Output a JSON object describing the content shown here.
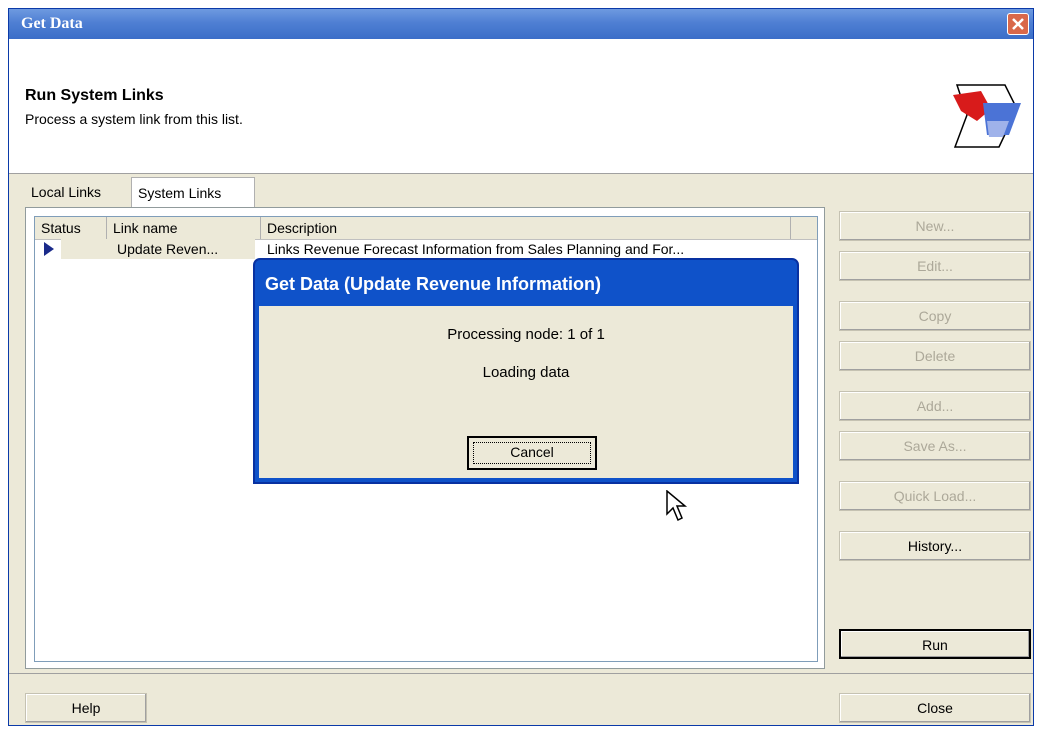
{
  "window": {
    "title": "Get Data"
  },
  "header": {
    "title": "Run System Links",
    "subtitle": "Process a system link from this list."
  },
  "tabs": [
    {
      "label": "Local Links"
    },
    {
      "label": "System Links"
    }
  ],
  "listview": {
    "columns": [
      "Status",
      "Link name",
      "Description"
    ],
    "rows": [
      {
        "link_name": "Update Reven...",
        "description": "Links Revenue Forecast Information from Sales Planning and For..."
      }
    ]
  },
  "buttons": {
    "new": "New...",
    "edit": "Edit...",
    "copy": "Copy",
    "delete": "Delete",
    "add": "Add...",
    "save_as": "Save As...",
    "quick_load": "Quick Load...",
    "history": "History...",
    "run": "Run",
    "help": "Help",
    "close": "Close"
  },
  "modal": {
    "title": "Get Data (Update Revenue Information)",
    "progress_text": "Processing node: 1 of 1",
    "status_text": "Loading data",
    "cancel_label": "Cancel"
  },
  "colors": {
    "titlebar": "#4f7fd3",
    "modal_title": "#0f52c9",
    "dialog_bg": "#ece9d8"
  }
}
